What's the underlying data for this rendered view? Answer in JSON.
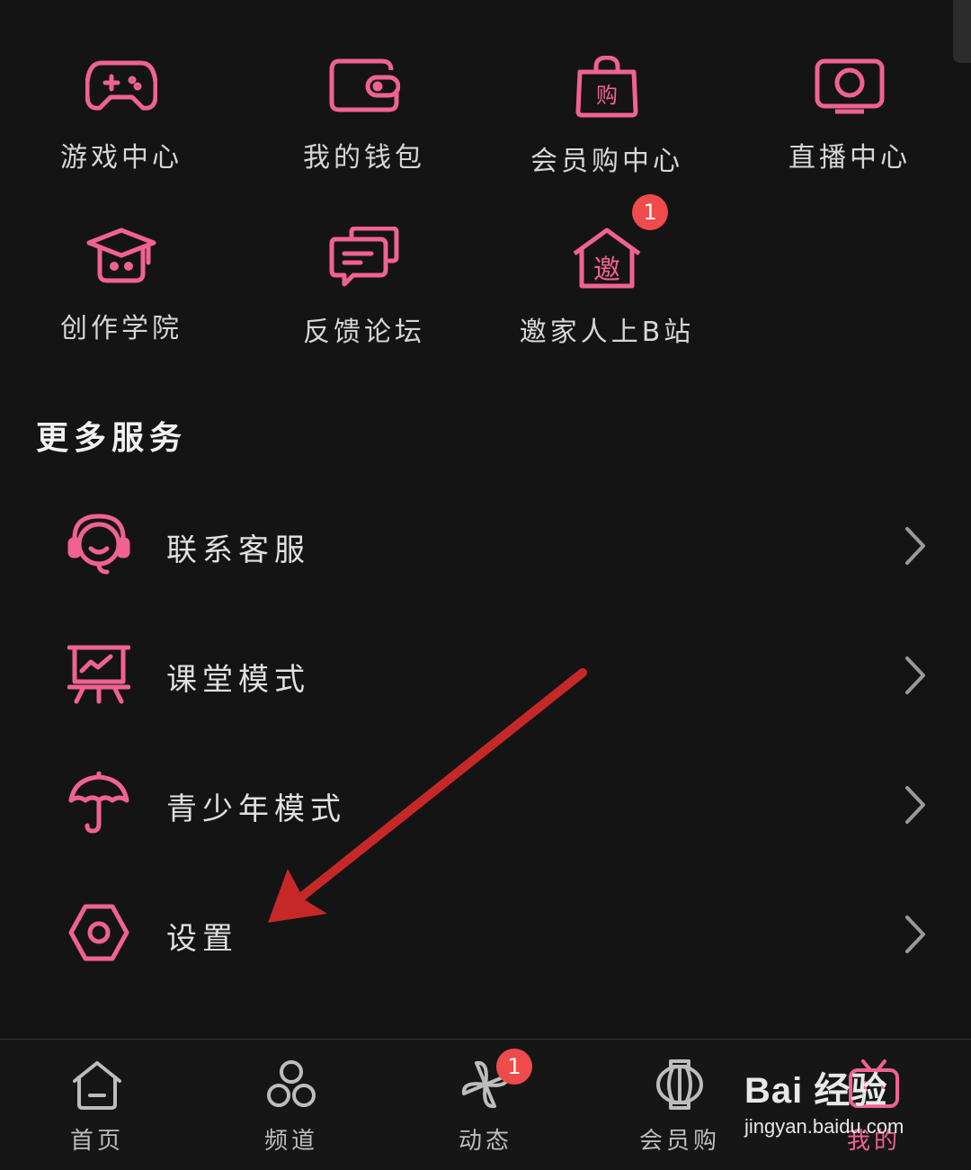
{
  "colors": {
    "accent": "#f06292",
    "badge": "#f04b4b",
    "arrow": "#c62828",
    "background": "#141414"
  },
  "grid": [
    {
      "label": "游戏中心",
      "icon": "gamepad-icon"
    },
    {
      "label": "我的钱包",
      "icon": "wallet-icon"
    },
    {
      "label": "会员购中心",
      "icon": "shopping-bag-icon"
    },
    {
      "label": "直播中心",
      "icon": "tv-live-icon"
    },
    {
      "label": "创作学院",
      "icon": "graduation-cap-icon"
    },
    {
      "label": "反馈论坛",
      "icon": "chat-bubbles-icon"
    },
    {
      "label": "邀家人上B站",
      "icon": "invite-house-icon",
      "badge": "1"
    }
  ],
  "more_services": {
    "title": "更多服务",
    "items": [
      {
        "label": "联系客服",
        "icon": "headset-icon"
      },
      {
        "label": "课堂模式",
        "icon": "classroom-board-icon"
      },
      {
        "label": "青少年模式",
        "icon": "umbrella-icon"
      },
      {
        "label": "设置",
        "icon": "settings-hexagon-icon"
      }
    ]
  },
  "bottom_nav": [
    {
      "label": "首页",
      "icon": "home-icon"
    },
    {
      "label": "频道",
      "icon": "channels-icon"
    },
    {
      "label": "动态",
      "icon": "pinwheel-icon",
      "badge": "1"
    },
    {
      "label": "会员购",
      "icon": "lantern-icon"
    },
    {
      "label": "我的",
      "icon": "bilibili-tv-icon",
      "active": true
    }
  ],
  "watermark": {
    "logo": "Bai 经验",
    "url": "jingyan.baidu.com"
  }
}
